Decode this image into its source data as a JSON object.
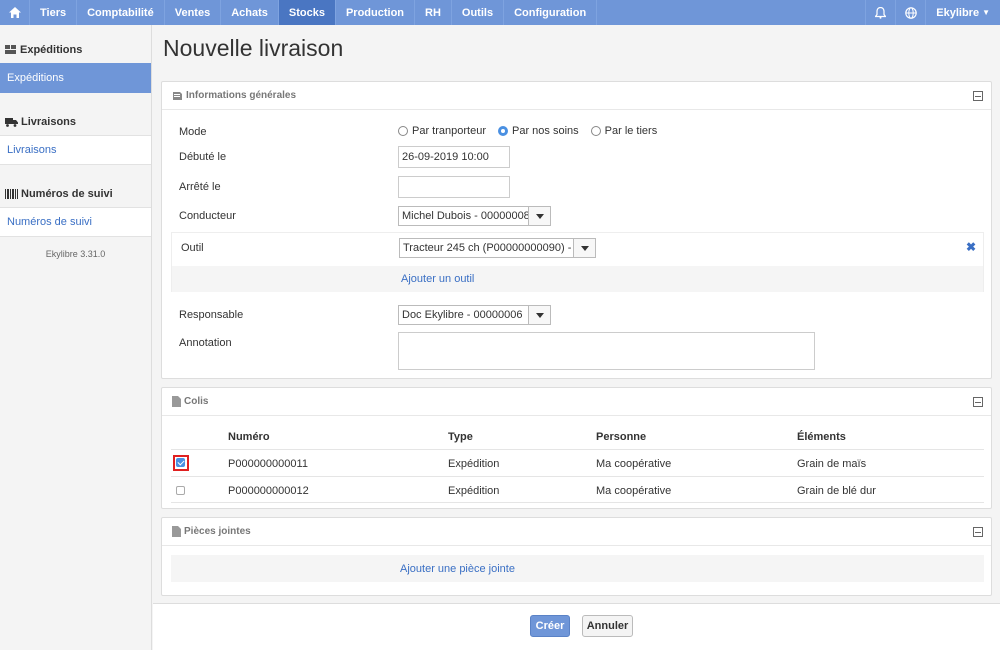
{
  "topnav": {
    "items": [
      "Tiers",
      "Comptabilité",
      "Ventes",
      "Achats",
      "Stocks",
      "Production",
      "RH",
      "Outils",
      "Configuration"
    ],
    "active": "Stocks",
    "user": "Ekylibre"
  },
  "sidebar": {
    "sections": [
      {
        "title": "Expéditions",
        "item": "Expéditions"
      },
      {
        "title": "Livraisons",
        "item": "Livraisons"
      },
      {
        "title": "Numéros de suivi",
        "item": "Numéros de suivi"
      }
    ],
    "version": "Ekylibre 3.31.0"
  },
  "page": {
    "title": "Nouvelle livraison"
  },
  "general": {
    "title": "Informations générales",
    "mode_label": "Mode",
    "mode_options": [
      "Par tranporteur",
      "Par nos soins",
      "Par le tiers"
    ],
    "mode_selected": "Par nos soins",
    "started_label": "Débuté le",
    "started_value": "26-09-2019 10:00",
    "stopped_label": "Arrêté le",
    "stopped_value": "",
    "driver_label": "Conducteur",
    "driver_value": "Michel Dubois - 00000008",
    "tool_label": "Outil",
    "tool_value": "Tracteur 245 ch (P00000000090) -",
    "add_tool": "Ajouter un outil",
    "responsible_label": "Responsable",
    "responsible_value": "Doc Ekylibre - 00000006",
    "annotation_label": "Annotation"
  },
  "parcels": {
    "title": "Colis",
    "headers": [
      "Numéro",
      "Type",
      "Personne",
      "Éléments"
    ],
    "rows": [
      {
        "checked": true,
        "number": "P000000000011",
        "type": "Expédition",
        "person": "Ma coopérative",
        "items": "Grain de maïs"
      },
      {
        "checked": false,
        "number": "P000000000012",
        "type": "Expédition",
        "person": "Ma coopérative",
        "items": "Grain de blé dur"
      }
    ]
  },
  "attachments": {
    "title": "Pièces jointes",
    "add": "Ajouter une pièce jointe"
  },
  "actions": {
    "create": "Créer",
    "cancel": "Annuler"
  },
  "colors": {
    "nav": "#6f96d8",
    "nav_active": "#4a76c2",
    "link": "#3a6fc4",
    "highlight": "#e02020"
  }
}
